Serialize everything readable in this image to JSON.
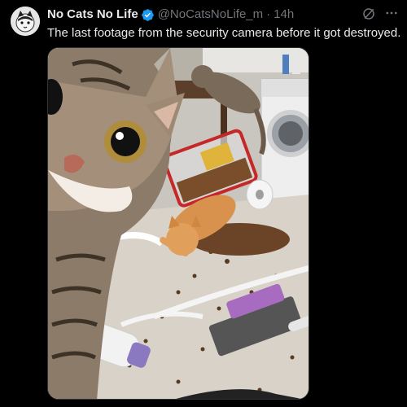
{
  "tweet": {
    "display_name": "No Cats No Life",
    "handle": "@NoCatsNoLife_m",
    "separator": "·",
    "time": "14h",
    "text": "The last footage from the security camera before it got destroyed.",
    "avatar_icon": "cat-avatar-icon",
    "verified_icon": "verified-badge-icon",
    "grok_icon": "grok-icon",
    "more_icon": "more-options-icon"
  },
  "colors": {
    "background": "#000000",
    "text_primary": "#e7e9ea",
    "text_secondary": "#71767b",
    "verified_blue": "#1d9bf0"
  }
}
